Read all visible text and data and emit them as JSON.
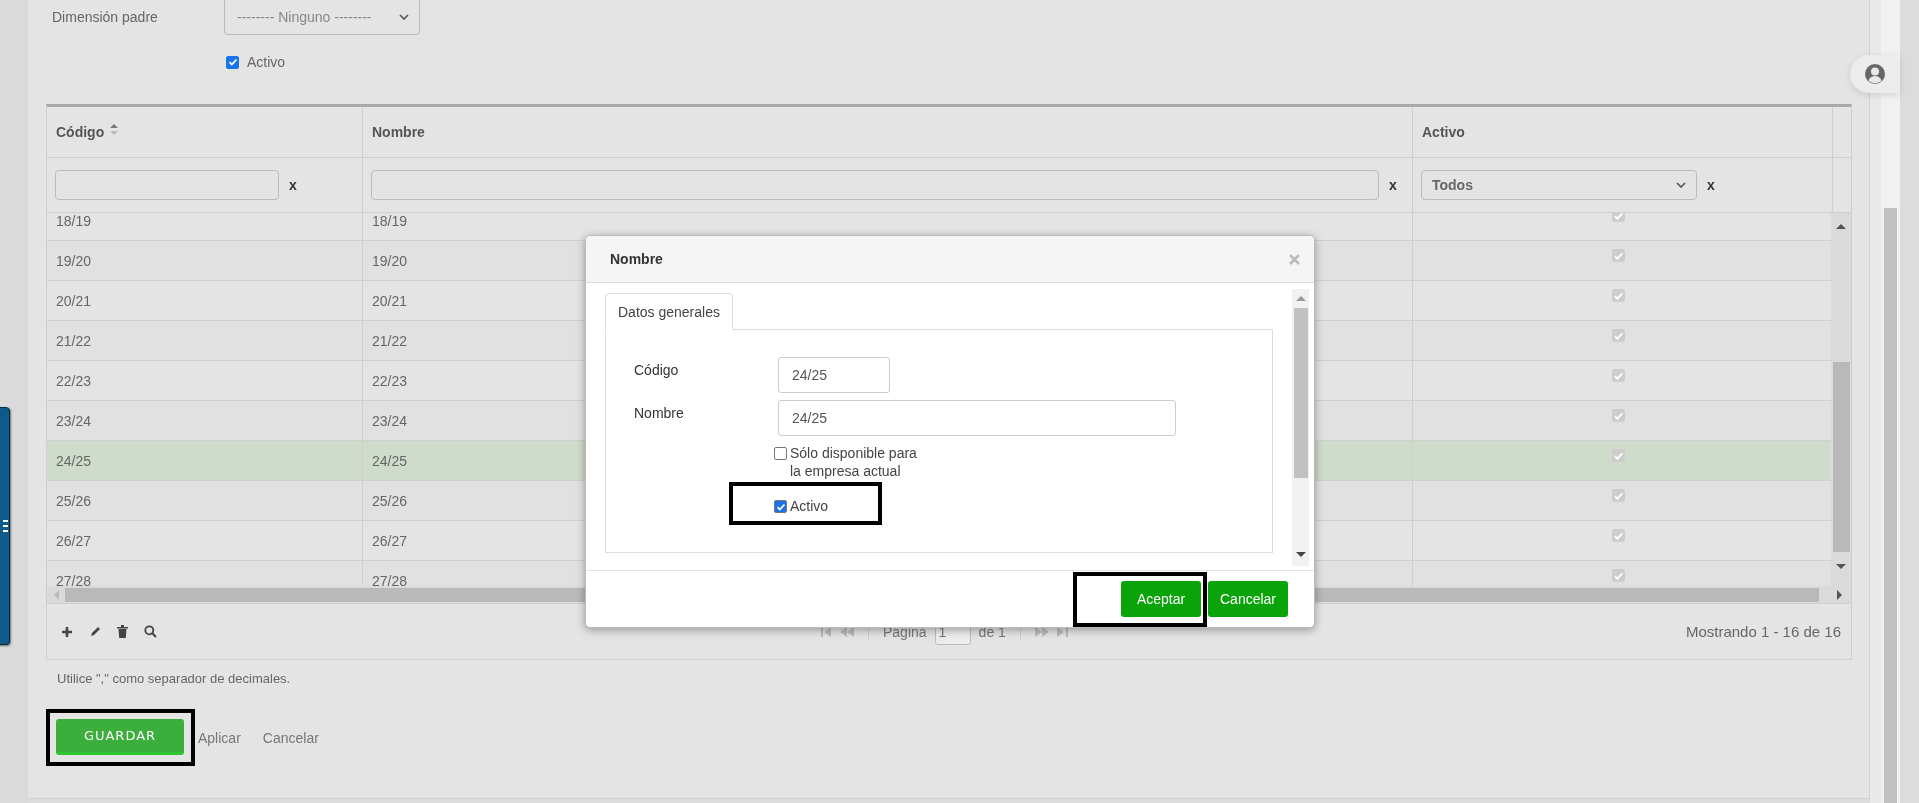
{
  "form": {
    "parent_label": "Dimensión padre",
    "parent_select": "-------- Ninguno --------",
    "active": {
      "label": "Activo",
      "checked": true
    }
  },
  "table": {
    "columns": [
      {
        "label": "Código",
        "sorted": true
      },
      {
        "label": "Nombre",
        "sorted": false
      },
      {
        "label": "Activo",
        "sorted": false
      }
    ],
    "filters": [
      {
        "kind": "text",
        "clear": "x"
      },
      {
        "kind": "text",
        "clear": "x"
      },
      {
        "kind": "select",
        "value": "Todos",
        "clear": "x"
      }
    ],
    "rows": [
      {
        "codigo": "18/19",
        "nombre": "18/19",
        "activo": true,
        "selected": false
      },
      {
        "codigo": "19/20",
        "nombre": "19/20",
        "activo": true,
        "selected": false
      },
      {
        "codigo": "20/21",
        "nombre": "20/21",
        "activo": true,
        "selected": false
      },
      {
        "codigo": "21/22",
        "nombre": "21/22",
        "activo": true,
        "selected": false
      },
      {
        "codigo": "22/23",
        "nombre": "22/23",
        "activo": true,
        "selected": false
      },
      {
        "codigo": "23/24",
        "nombre": "23/24",
        "activo": true,
        "selected": false
      },
      {
        "codigo": "24/25",
        "nombre": "24/25",
        "activo": true,
        "selected": true
      },
      {
        "codigo": "25/26",
        "nombre": "25/26",
        "activo": true,
        "selected": false
      },
      {
        "codigo": "26/27",
        "nombre": "26/27",
        "activo": true,
        "selected": false
      },
      {
        "codigo": "27/28",
        "nombre": "27/28",
        "activo": true,
        "selected": false
      }
    ]
  },
  "pager": {
    "page_label": "Página",
    "page": "1",
    "of": "de 1",
    "summary": "Mostrando 1 - 16 de 16"
  },
  "note": "Utilice \",\" como separador de decimales.",
  "actions": [
    {
      "kind": "primary",
      "label": "GUARDAR",
      "highlighted": true
    },
    {
      "kind": "link",
      "label": "Aplicar",
      "highlighted": false
    },
    {
      "kind": "link",
      "label": "Cancelar",
      "highlighted": false
    }
  ],
  "dialog": {
    "title": "Nombre",
    "tabs": [
      {
        "label": "Datos generales",
        "selected": true
      }
    ],
    "fields": [
      {
        "label": "Código",
        "value": "24/25",
        "kind": "short"
      },
      {
        "label": "Nombre",
        "value": "24/25",
        "kind": "long"
      }
    ],
    "checks": [
      {
        "label": "Sólo disponible para la empresa actual",
        "checked": false,
        "highlighted": false
      },
      {
        "label": "Activo",
        "checked": true,
        "highlighted": true
      }
    ],
    "buttons": [
      {
        "label": "Aceptar",
        "highlighted": true
      },
      {
        "label": "Cancelar",
        "highlighted": false
      }
    ]
  }
}
